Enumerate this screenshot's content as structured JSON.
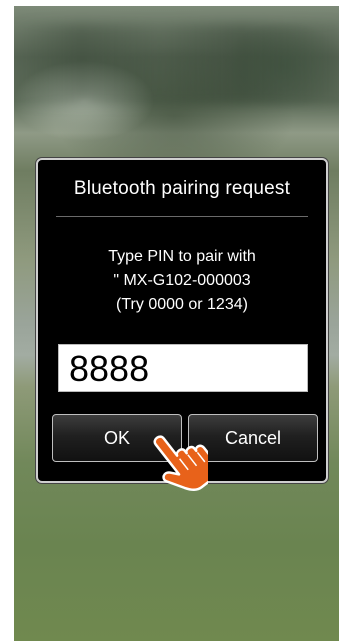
{
  "dialog": {
    "title": "Bluetooth pairing  request",
    "message_line1": "Type PIN to pair with",
    "message_line2": "\" MX-G102-000003",
    "message_line3": "(Try 0000 or 1234)"
  },
  "pin_field": {
    "value": "8888"
  },
  "buttons": {
    "ok_label": "OK",
    "cancel_label": "Cancel"
  },
  "annotation": {
    "pointer_icon": "hand-pointer-icon",
    "pointer_color": "#e8621a"
  }
}
